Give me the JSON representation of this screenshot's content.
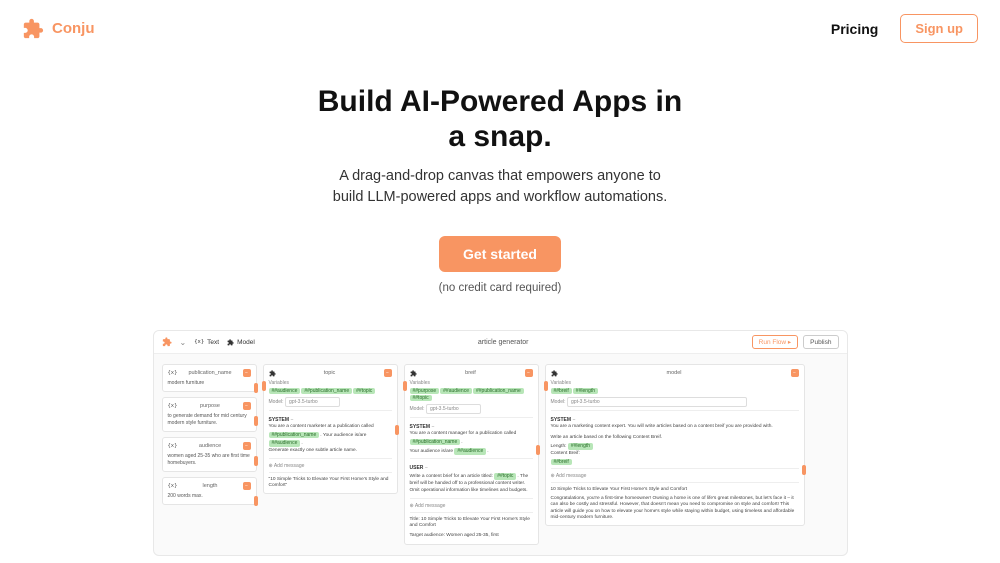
{
  "header": {
    "brand": "Conju",
    "pricing": "Pricing",
    "signup": "Sign up"
  },
  "hero": {
    "title_l1": "Build AI-Powered Apps in",
    "title_l2": "a snap.",
    "sub_l1": "A drag-and-drop canvas that empowers anyone to",
    "sub_l2": "build LLM-powered apps and workflow automations.",
    "cta": "Get started",
    "nocc": "(no credit card required)"
  },
  "canvas": {
    "toolbar": {
      "text_tool": "Text",
      "model_tool": "Model",
      "title": "article generator",
      "run": "Run Flow ▸",
      "publish": "Publish"
    },
    "col1": {
      "c1": {
        "icon": "{x}",
        "title": "publication_name",
        "body": "modern furniture"
      },
      "c2": {
        "icon": "{x}",
        "title": "purpose",
        "body": "to generate demand for mid century modern style furniture."
      },
      "c3": {
        "icon": "{x}",
        "title": "audience",
        "body": "women aged 25-35 who are first time homebuyers."
      },
      "c4": {
        "icon": "{x}",
        "title": "length",
        "body": "200 words max."
      }
    },
    "col2": {
      "title": "topic",
      "vars_label": "Variables",
      "vars": [
        "##audience",
        "##publication_name",
        "##topic"
      ],
      "model_label": "Model:",
      "model": "gpt-3.5-turbo",
      "system": "SYSTEM",
      "system_text_1": "You are a content marketer at a publication called ",
      "system_tag_1": "##publication_name",
      "system_text_2": ". Your audience is/are ",
      "system_tag_2": "##audience",
      "system_text_3": "Generate exactly one subtle article name.",
      "add": "Add message",
      "output": "\"10 Simple Tricks to Elevate Your First Home's Style and Comfort\""
    },
    "col3": {
      "title": "breif",
      "vars_label": "Variables",
      "vars": [
        "##purpose",
        "##audience",
        "##publication_name",
        "##topic"
      ],
      "model_label": "Model:",
      "model": "gpt-3.5-turbo",
      "system": "SYSTEM",
      "system_text_1": "You are a content manager for a publication called ",
      "system_tag_1": "##publication_name",
      "system_text_2": "Your audience is/are ",
      "system_tag_2": "##audience",
      "user": "USER",
      "user_text_1": "Write a content brief for an article titled: ",
      "user_tag_1": "##topic",
      "user_text_2": ". The breif will be handed off to a professional content writer.",
      "user_text_3": "Omit operational information like timelines and budgets.",
      "add": "Add message",
      "output_1": "Title: 10 Simple Tricks to Elevate Your First Home's Style and Comfort",
      "output_2": "Target audience: Women aged 25-35, first"
    },
    "col4": {
      "title": "model",
      "vars_label": "Variables",
      "vars": [
        "##breif",
        "##length"
      ],
      "model_label": "Model:",
      "model": "gpt-3.5-turbo",
      "system": "SYSTEM",
      "system_text": "You are a marketing content expert. You will write articles based on a content breif you are provided with.",
      "body_1": "Write an article based on the following Content Breif.",
      "body_2a": "Length: ",
      "body_2_tag": "##length",
      "body_3": "Content Breif:",
      "body_3_tag": "##breif",
      "add": "Add message",
      "output_title": "10 Simple Tricks to Elevate Your First Home's Style and Comfort",
      "output_body": "Congratulations, you're a first-time homeowner! Owning a home is one of life's great milestones, but let's face it – it can also be costly and stressful. However, that doesn't mean you need to compromise on style and comfort! This article will guide you on how to elevate your home's style while staying within budget, using timeless and affordable mid-century modern furniture."
    }
  }
}
